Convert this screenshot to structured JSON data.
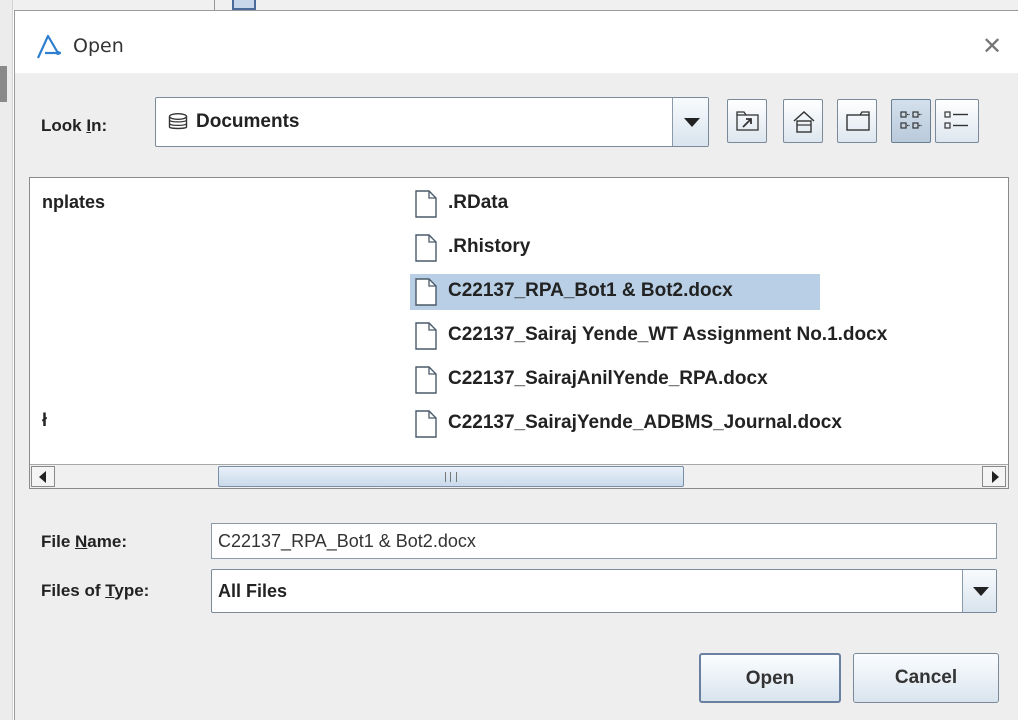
{
  "dialog": {
    "title": "Open"
  },
  "look_in": {
    "label_pre": "Look ",
    "label_mnemonic": "I",
    "label_post": "n:",
    "value": "Documents",
    "icon": "disk-icon"
  },
  "toolbar": {
    "buttons": [
      {
        "name": "up-one-level-icon"
      },
      {
        "name": "home-icon"
      },
      {
        "name": "new-folder-icon"
      },
      {
        "name": "list-view-icon",
        "active": true
      },
      {
        "name": "details-view-icon"
      }
    ]
  },
  "file_list": {
    "left_column": [
      {
        "label": "nplates"
      },
      {
        "label": "ł"
      }
    ],
    "files": [
      {
        "name": ".RData",
        "selected": false
      },
      {
        "name": ".Rhistory",
        "selected": false
      },
      {
        "name": "C22137_RPA_Bot1 & Bot2.docx",
        "selected": true
      },
      {
        "name": "C22137_Sairaj Yende_WT Assignment No.1.docx",
        "selected": false
      },
      {
        "name": "C22137_SairajAnilYende_RPA.docx",
        "selected": false
      },
      {
        "name": "C22137_SairajYende_ADBMS_Journal.docx",
        "selected": false
      }
    ]
  },
  "file_name": {
    "label_pre": "File ",
    "label_mnemonic": "N",
    "label_post": "ame:",
    "value": "C22137_RPA_Bot1 & Bot2.docx"
  },
  "files_of_type": {
    "label_pre": "Files of ",
    "label_mnemonic": "T",
    "label_post": "ype:",
    "value": "All Files"
  },
  "buttons": {
    "open": "Open",
    "cancel": "Cancel"
  },
  "colors": {
    "selection": "#b8cfe5",
    "accent": "#2f7fd0"
  }
}
